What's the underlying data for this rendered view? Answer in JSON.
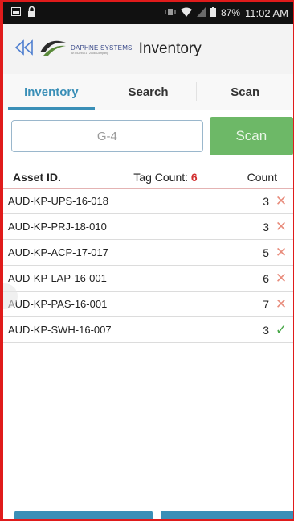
{
  "status_bar": {
    "battery": "87%",
    "time": "11:02 AM"
  },
  "app_bar": {
    "logo_name": "DAPHNE SYSTEMS",
    "logo_tagline": "An ISO 9001 : 2008 Company",
    "title": "Inventory"
  },
  "tabs": [
    {
      "label": "Inventory",
      "active": true
    },
    {
      "label": "Search",
      "active": false
    },
    {
      "label": "Scan",
      "active": false
    }
  ],
  "search": {
    "value": "G-4",
    "scan_label": "Scan"
  },
  "table": {
    "headers": {
      "asset_id": "Asset ID.",
      "tag_count_label": "Tag Count: ",
      "tag_count_value": "6",
      "count": "Count"
    },
    "rows": [
      {
        "asset_id": "AUD-KP-UPS-16-018",
        "count": "3",
        "status": "✕"
      },
      {
        "asset_id": "AUD-KP-PRJ-18-010",
        "count": "3",
        "status": "✕"
      },
      {
        "asset_id": "AUD-KP-ACP-17-017",
        "count": "5",
        "status": "✕"
      },
      {
        "asset_id": "AUD-KP-LAP-16-001",
        "count": "6",
        "status": "✕"
      },
      {
        "asset_id": "AUD-KP-PAS-16-001",
        "count": "7",
        "status": "✕"
      },
      {
        "asset_id": "AUD-KP-SWH-16-007",
        "count": "3",
        "status": "✓"
      }
    ]
  },
  "colors": {
    "accent": "#3a8fb7",
    "scan_button": "#6db867",
    "mismatch": "#e88c7c",
    "match": "#4aa84a",
    "tag_count": "#d23030"
  }
}
